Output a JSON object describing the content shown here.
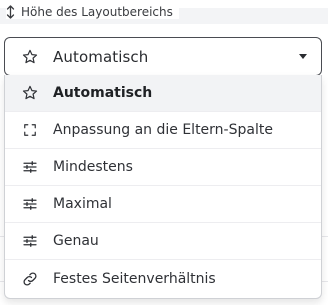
{
  "field": {
    "label": "Höhe des Layoutbereichs",
    "label_icon": "resize-vertical-icon"
  },
  "select": {
    "value": "Automatisch",
    "icon": "star-outline-icon"
  },
  "menu": {
    "items": [
      {
        "label": "Automatisch",
        "icon": "star-outline-icon",
        "selected": true
      },
      {
        "label": "Anpassung an die Eltern-Spalte",
        "icon": "fit-frame-icon",
        "selected": false
      },
      {
        "label": "Mindestens",
        "icon": "sliders-icon",
        "selected": false
      },
      {
        "label": "Maximal",
        "icon": "sliders-icon",
        "selected": false
      },
      {
        "label": "Genau",
        "icon": "sliders-icon",
        "selected": false
      },
      {
        "label": "Festes Seitenverhältnis",
        "icon": "link-icon",
        "selected": false
      }
    ]
  },
  "colors": {
    "text": "#2f3136",
    "border": "#4a4c52",
    "selected_bg": "#f2f3f5"
  }
}
